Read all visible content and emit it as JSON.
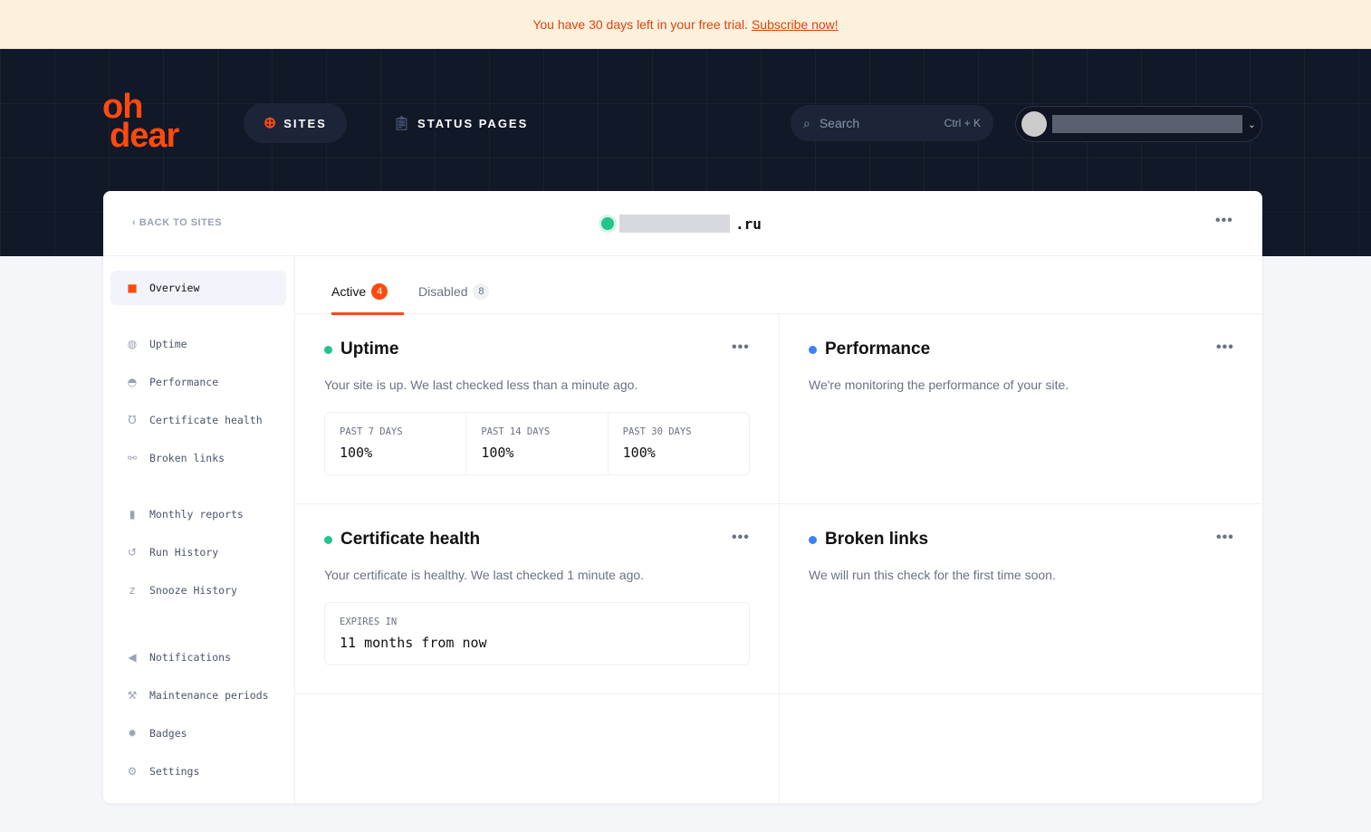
{
  "banner": {
    "text": "You have 30 days left in your free trial.",
    "link": "Subscribe now!"
  },
  "header": {
    "logo": [
      "oh",
      "dear"
    ],
    "nav": [
      {
        "label": "SITES",
        "icon": "globe-icon"
      },
      {
        "label": "STATUS PAGES",
        "icon": "clipboard-icon"
      }
    ],
    "search": {
      "placeholder": "Search",
      "shortcut": "Ctrl + K"
    }
  },
  "site": {
    "back": "BACK TO SITES",
    "domain_suffix": ".ru",
    "status_color": "#22c58b"
  },
  "sidebar": {
    "items": [
      {
        "label": "Overview",
        "icon": "grid-icon"
      },
      {
        "label": "Uptime",
        "icon": "globe-icon"
      },
      {
        "label": "Performance",
        "icon": "gauge-icon"
      },
      {
        "label": "Certificate health",
        "icon": "stethoscope-icon"
      },
      {
        "label": "Broken links",
        "icon": "broken-link-icon"
      },
      {
        "label": "Monthly reports",
        "icon": "document-icon"
      },
      {
        "label": "Run History",
        "icon": "history-icon"
      },
      {
        "label": "Snooze History",
        "icon": "snooze-icon"
      },
      {
        "label": "Notifications",
        "icon": "megaphone-icon"
      },
      {
        "label": "Maintenance periods",
        "icon": "wrench-icon"
      },
      {
        "label": "Badges",
        "icon": "badge-icon"
      },
      {
        "label": "Settings",
        "icon": "gears-icon"
      }
    ]
  },
  "tabs": [
    {
      "label": "Active",
      "count": "4"
    },
    {
      "label": "Disabled",
      "count": "8"
    }
  ],
  "checks": {
    "uptime": {
      "title": "Uptime",
      "desc": "Your site is up. We last checked less than a minute ago.",
      "stats": [
        {
          "label": "PAST 7 DAYS",
          "value": "100%"
        },
        {
          "label": "PAST 14 DAYS",
          "value": "100%"
        },
        {
          "label": "PAST 30 DAYS",
          "value": "100%"
        }
      ]
    },
    "performance": {
      "title": "Performance",
      "desc": "We're monitoring the performance of your site."
    },
    "certificate": {
      "title": "Certificate health",
      "desc": "Your certificate is healthy. We last checked 1 minute ago.",
      "stats": [
        {
          "label": "EXPIRES IN",
          "value": "11 months from now"
        }
      ]
    },
    "broken": {
      "title": "Broken links",
      "desc": "We will run this check for the first time soon."
    }
  },
  "colors": {
    "accent": "#ff4a0f",
    "green": "#22c58b",
    "blue": "#3b82f6"
  }
}
